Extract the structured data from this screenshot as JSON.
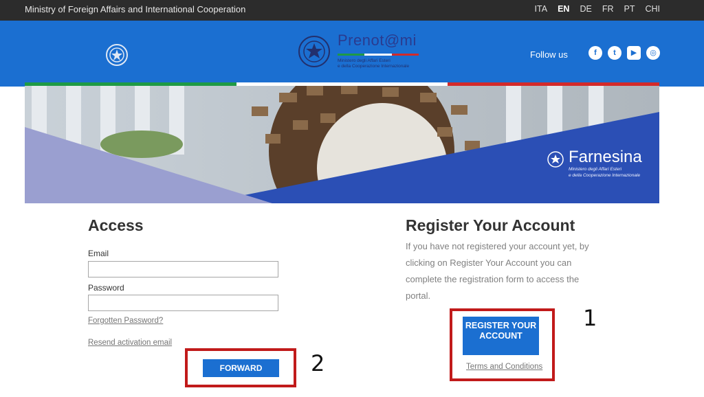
{
  "topbar": {
    "ministry": "Ministry of Foreign Affairs and International Cooperation",
    "languages": [
      "ITA",
      "EN",
      "DE",
      "FR",
      "PT",
      "CHI"
    ],
    "active_language": "EN"
  },
  "header": {
    "brand": "Prenot@mi",
    "brand_sub_line1": "Ministero degli Affari Esteri",
    "brand_sub_line2": "e della Cooperazione Internazionale",
    "follow_label": "Follow us",
    "social": [
      {
        "name": "facebook",
        "glyph": "f"
      },
      {
        "name": "twitter",
        "glyph": "t"
      },
      {
        "name": "youtube",
        "glyph": "▶"
      },
      {
        "name": "instagram",
        "glyph": "◎"
      }
    ]
  },
  "banner": {
    "name": "Farnesina",
    "sub_line1": "Ministero degli Affari Esteri",
    "sub_line2": "e della Cooperazione Internazionale"
  },
  "access": {
    "title": "Access",
    "email_label": "Email",
    "email_value": "",
    "password_label": "Password",
    "password_value": "",
    "forgot_link": "Forgotten Password?",
    "resend_link": "Resend activation email",
    "forward_button": "FORWARD"
  },
  "register": {
    "title": "Register Your Account",
    "description": "If you have not registered your account yet, by clicking on Register Your Account you can complete the registration form to access the portal.",
    "button": "REGISTER YOUR ACCOUNT",
    "terms_link": "Terms and Conditions"
  },
  "annotations": {
    "register_number": "1",
    "forward_number": "2"
  },
  "colors": {
    "topbar": "#2c2c2c",
    "header_blue": "#1b6fd1",
    "flag_green": "#1f9a45",
    "flag_white": "#ffffff",
    "flag_red": "#d32a2a",
    "callout_red": "#c11a1a"
  }
}
